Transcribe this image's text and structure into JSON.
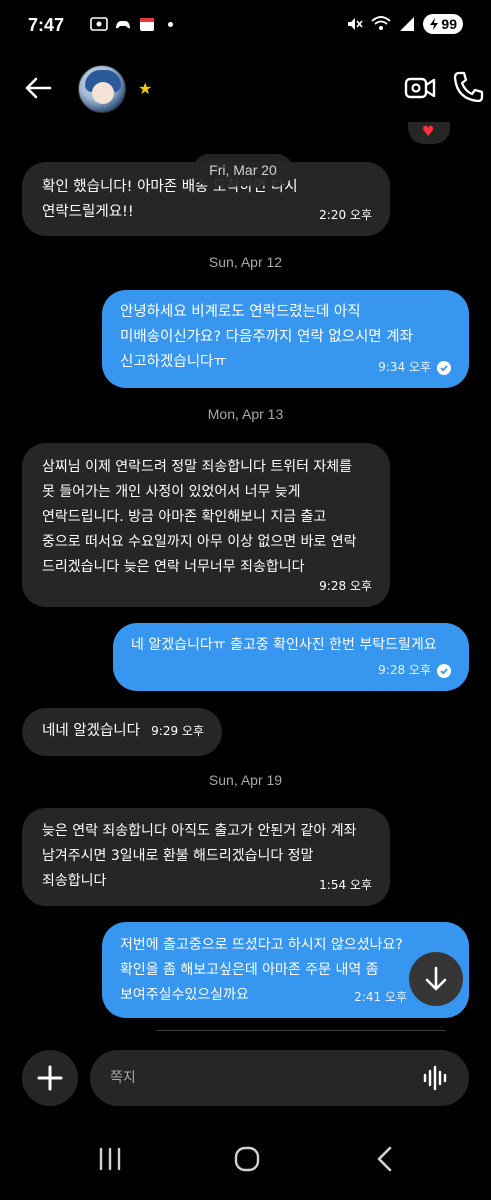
{
  "status_bar": {
    "time": "7:47",
    "battery": "99"
  },
  "header": {
    "star": "★"
  },
  "sticky_date": "Fri, Mar 20",
  "dates": [
    "Sun, Apr 12",
    "Mon, Apr 13",
    "Sun, Apr 19"
  ],
  "messages": [
    {
      "direction": "in",
      "text": "확인 했습니다! 아마존 배송 도착하면 다시\n연락드릴게요!!",
      "time": "2:20 오후"
    },
    {
      "direction": "out",
      "text": "안녕하세요 비계로도 연락드렸는데 아직\n미배송이신가요? 다음주까지 연락 없으시면 계좌\n신고하겠습니다ㅠ",
      "time": "9:34 오후"
    },
    {
      "direction": "in",
      "text": "삼찌님 이제 연락드려 정말 죄송합니다 트위터 자체를\n못 들어가는 개인 사정이 있었어서 너무 늦게\n연락드립니다. 방금 아마존 확인해보니 지금 출고\n중으로 떠서요 수요일까지 아무 이상 없으면 바로 연락\n드리겠습니다 늦은 연락 너무너무 죄송합니다",
      "time": "9:28 오후"
    },
    {
      "direction": "out",
      "text": "네 알겠습니다ㅠ 출고중 확인사진 한번 부탁드릴게요",
      "time": "9:28 오후"
    },
    {
      "direction": "in",
      "text": "네네 알겠습니다",
      "time": "9:29 오후"
    },
    {
      "direction": "in",
      "text": "늦은 연락 죄송합니다 아직도 출고가 안된거 같아 계좌\n남겨주시면 3일내로  환불 해드리겠습니다 정말\n죄송합니다",
      "time": "1:54 오후"
    },
    {
      "direction": "out",
      "text": "저번에 출고중으로 뜨셨다고 하시지 않으셨나요?\n확인을 좀 해보고싶은데 아마존 주문 내역 좀\n보여주실수있으실까요",
      "time": "2:41 오후"
    }
  ],
  "composer": {
    "placeholder": "쪽지"
  },
  "colors": {
    "outgoing_bubble": "#3797f0",
    "incoming_bubble": "#262626",
    "background": "#000000"
  }
}
